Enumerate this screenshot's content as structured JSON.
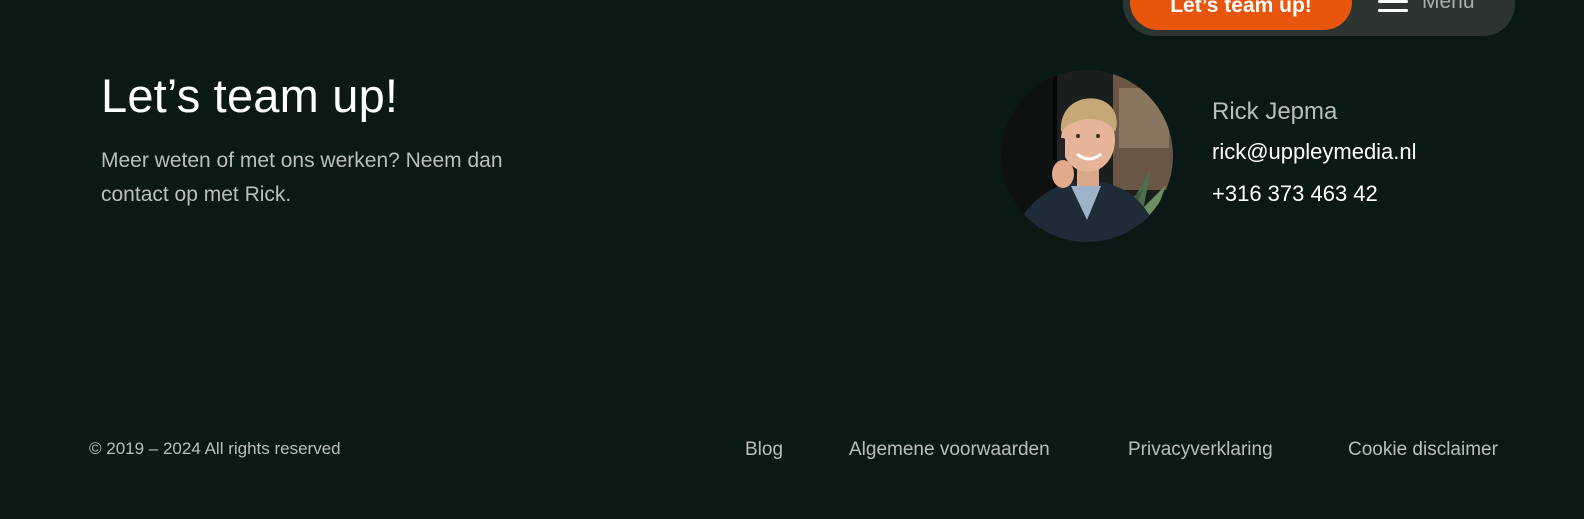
{
  "nav": {
    "cta_label": "Let’s team up!",
    "menu_label": "Menu"
  },
  "hero": {
    "title": "Let’s team up!",
    "intro": "Meer weten of met ons werken? Neem dan contact op met Rick."
  },
  "contact": {
    "name": "Rick Jepma",
    "email": "rick@uppleymedia.nl",
    "phone": "+316 373 463 42"
  },
  "footer": {
    "copyright": "© 2019 – 2024 All rights reserved",
    "links": [
      "Blog",
      "Algemene voorwaarden",
      "Privacyverklaring",
      "Cookie disclaimer"
    ]
  },
  "colors": {
    "background": "#0a1915",
    "accent": "#e8560d",
    "nav_pill": "#2b3431",
    "muted_text": "#b9bfbc"
  }
}
